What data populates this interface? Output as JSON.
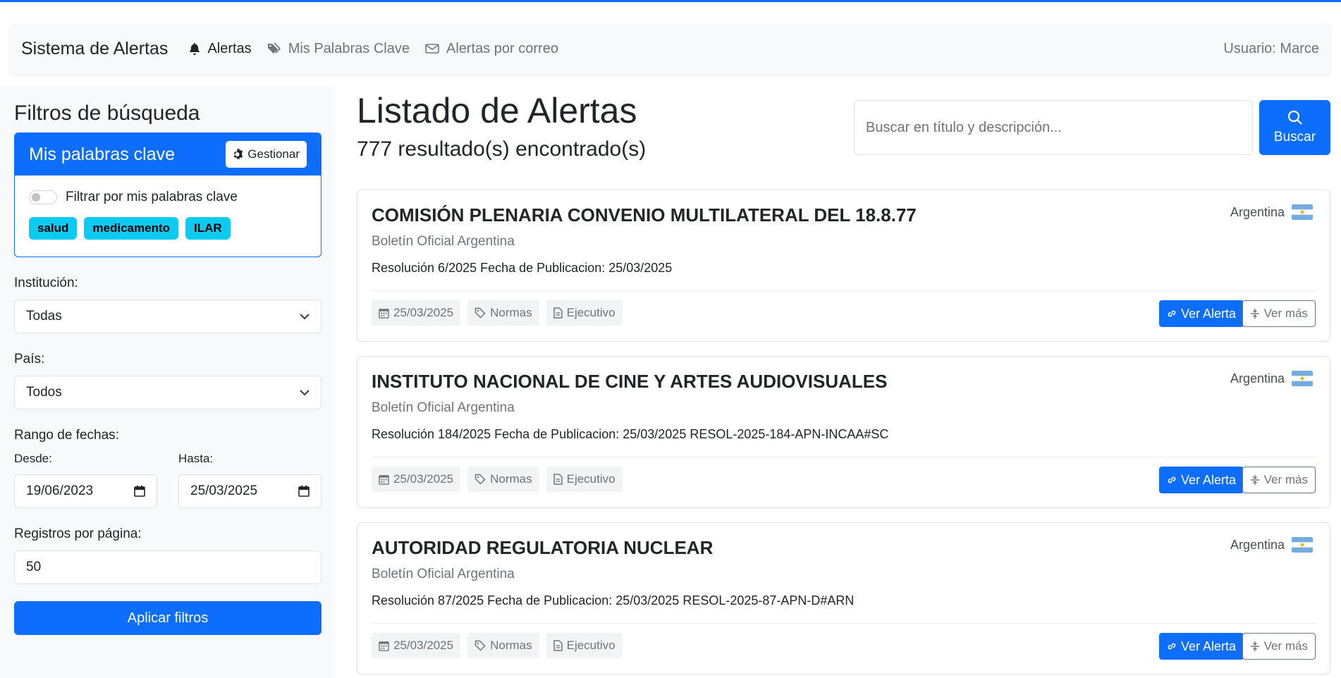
{
  "navbar": {
    "brand": "Sistema de Alertas",
    "links": [
      {
        "label": "Alertas",
        "icon": "bell-icon"
      },
      {
        "label": "Mis Palabras Clave",
        "icon": "tags-icon"
      },
      {
        "label": "Alertas por correo",
        "icon": "envelope-icon"
      }
    ],
    "user": "Usuario: Marce"
  },
  "sidebar": {
    "title": "Filtros de búsqueda",
    "keywords_card": {
      "title": "Mis palabras clave",
      "manage_label": "Gestionar",
      "switch_label": "Filtrar por mis palabras clave",
      "switch_on": false,
      "tags": [
        "salud",
        "medicamento",
        "ILAR"
      ]
    },
    "institucion": {
      "label": "Institución:",
      "value": "Todas"
    },
    "pais": {
      "label": "País:",
      "value": "Todos"
    },
    "fechas": {
      "label": "Rango de fechas:",
      "desde_label": "Desde:",
      "desde_value": "19/06/2023",
      "hasta_label": "Hasta:",
      "hasta_value": "25/03/2025"
    },
    "registros": {
      "label": "Registros por página:",
      "value": "50"
    },
    "apply_label": "Aplicar filtros"
  },
  "main": {
    "title": "Listado de Alertas",
    "results": "777 resultado(s) encontrado(s)",
    "search_placeholder": "Buscar en título y descripción...",
    "search_button": "Buscar",
    "alerts": [
      {
        "title": "COMISIÓN PLENARIA CONVENIO MULTILATERAL DEL 18.8.77",
        "country": "Argentina",
        "source": "Boletín Oficial Argentina",
        "description": "Resolución 6/2025 Fecha de Publicacion: 25/03/2025",
        "date": "25/03/2025",
        "category": "Normas",
        "power": "Ejecutivo",
        "view_label": "Ver Alerta",
        "more_label": "Ver más"
      },
      {
        "title": "INSTITUTO NACIONAL DE CINE Y ARTES AUDIOVISUALES",
        "country": "Argentina",
        "source": "Boletín Oficial Argentina",
        "description": "Resolución 184/2025 Fecha de Publicacion: 25/03/2025 RESOL-2025-184-APN-INCAA#SC",
        "date": "25/03/2025",
        "category": "Normas",
        "power": "Ejecutivo",
        "view_label": "Ver Alerta",
        "more_label": "Ver más"
      },
      {
        "title": "AUTORIDAD REGULATORIA NUCLEAR",
        "country": "Argentina",
        "source": "Boletín Oficial Argentina",
        "description": "Resolución 87/2025 Fecha de Publicacion: 25/03/2025 RESOL-2025-87-APN-D#ARN",
        "date": "25/03/2025",
        "category": "Normas",
        "power": "Ejecutivo",
        "view_label": "Ver Alerta",
        "more_label": "Ver más"
      }
    ]
  },
  "colors": {
    "primary": "#0d6efd",
    "info": "#0dcaf0",
    "muted": "#6c757d",
    "light": "#f8f9fa"
  }
}
